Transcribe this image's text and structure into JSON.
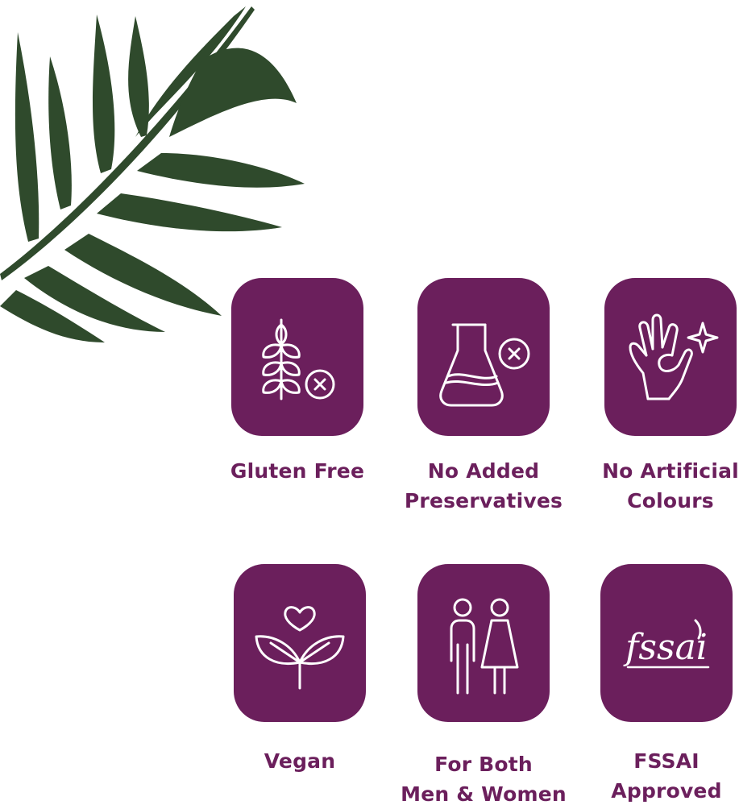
{
  "colors": {
    "tile": "#6b1f5c",
    "label": "#6b1f5c",
    "leaf": "#2f4a2c"
  },
  "decoration": {
    "icon": "palm-leaf-icon"
  },
  "features": [
    {
      "label": "Gluten Free",
      "icon": "wheat-crossed-icon"
    },
    {
      "label": "No Added\nPreservatives",
      "icon": "flask-crossed-icon"
    },
    {
      "label": "No Artificial\nColours",
      "icon": "ok-hand-sparkle-icon"
    },
    {
      "label": "Vegan",
      "icon": "leaves-heart-icon"
    },
    {
      "label": "For Both\nMen & Women",
      "icon": "man-woman-icon"
    },
    {
      "label": "FSSAI\nApproved",
      "icon": "fssai-logo-icon",
      "logo_text": "fssai"
    }
  ]
}
